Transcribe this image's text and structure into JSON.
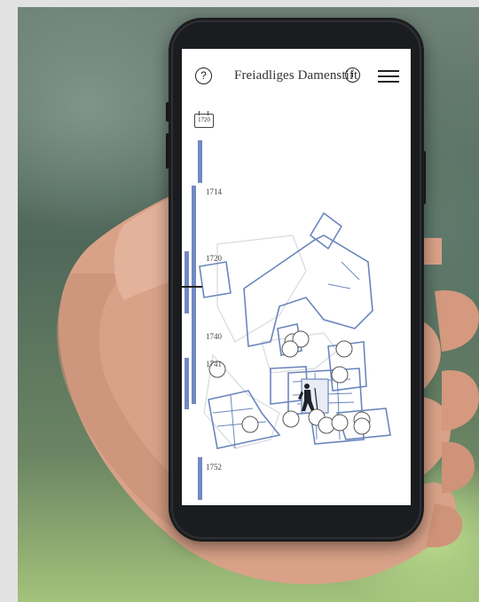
{
  "app": {
    "title": "Freiadliges Damenstift",
    "calendar_year": "1720"
  },
  "timeline": {
    "years": [
      "1714",
      "1720",
      "1740",
      "1741",
      "1752"
    ]
  },
  "icons": {
    "help": "?",
    "info": "i",
    "menu": "menu-icon",
    "calendar": "calendar-icon",
    "hiker": "hiker-icon"
  },
  "colors": {
    "plan_blue": "#6b86bd",
    "timeline_blue": "#7189c2"
  }
}
